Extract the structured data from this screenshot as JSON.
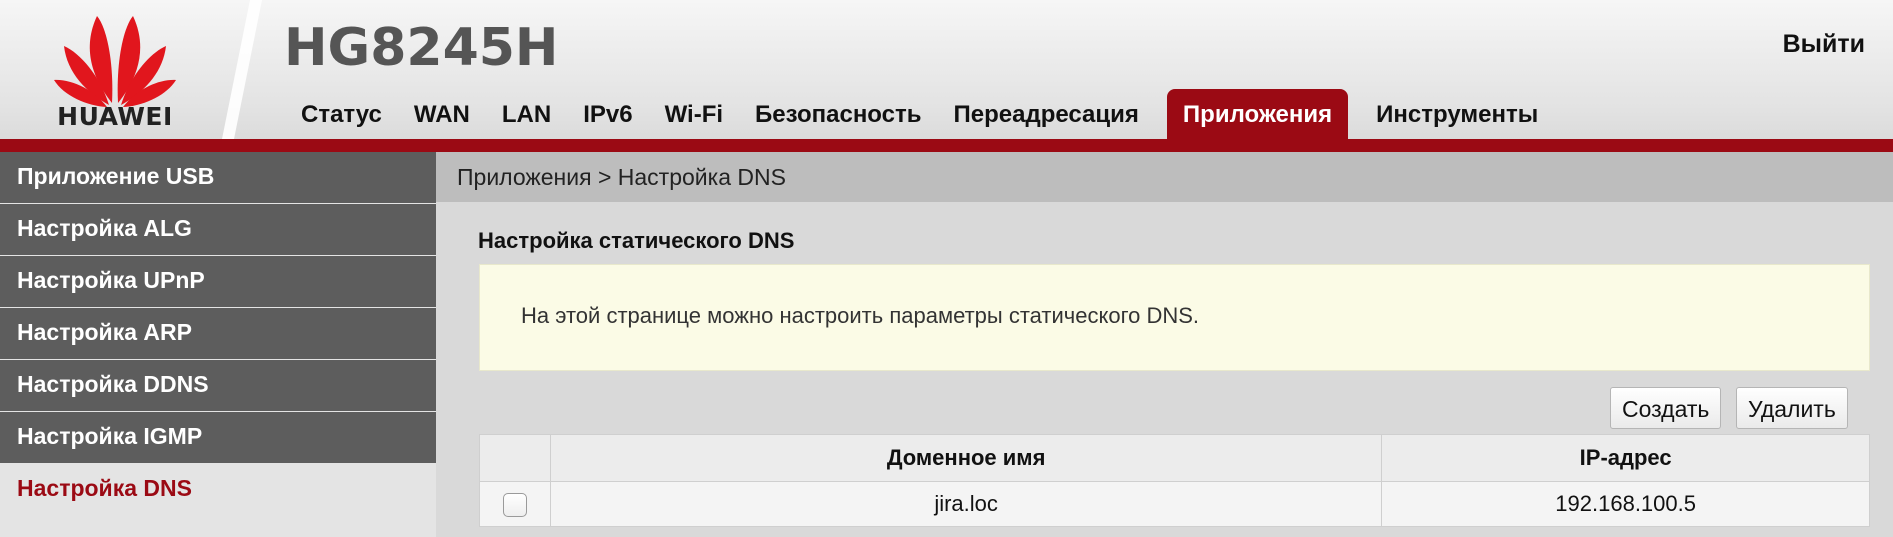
{
  "header": {
    "brand": "HUAWEI",
    "model": "HG8245H",
    "logout_label": "Выйти",
    "accent_color": "#9b0a14"
  },
  "nav": {
    "tabs": [
      {
        "label": "Статус"
      },
      {
        "label": "WAN"
      },
      {
        "label": "LAN"
      },
      {
        "label": "IPv6"
      },
      {
        "label": "Wi-Fi"
      },
      {
        "label": "Безопасность"
      },
      {
        "label": "Переадресация"
      },
      {
        "label": "Приложения",
        "active": true
      },
      {
        "label": "Инструменты"
      }
    ]
  },
  "sidebar": {
    "items": [
      {
        "label": "Приложение USB"
      },
      {
        "label": "Настройка ALG"
      },
      {
        "label": "Настройка UPnP"
      },
      {
        "label": "Настройка ARP"
      },
      {
        "label": "Настройка DDNS"
      },
      {
        "label": "Настройка IGMP"
      },
      {
        "label": "Настройка DNS",
        "active": true
      }
    ]
  },
  "main": {
    "breadcrumb": "Приложения > Настройка DNS",
    "section_title": "Настройка статического DNS",
    "info_text": "На этой странице можно настроить параметры статического DNS.",
    "create_label": "Создать",
    "delete_label": "Удалить",
    "table": {
      "headers": {
        "domain": "Доменное имя",
        "ip": "IP-адрес"
      },
      "rows": [
        {
          "checked": false,
          "domain": "jira.loc",
          "ip": "192.168.100.5"
        }
      ]
    }
  }
}
